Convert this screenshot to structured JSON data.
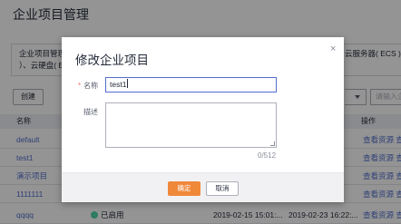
{
  "page": {
    "title": "企业项目管理",
    "notice": {
      "line1": "企业项目管理",
      "line2": "）、云硬盘( EVS",
      "line1_right": "云服务器( ECS )、列"
    },
    "create_label": "创建",
    "search_placeholder": "请输入企"
  },
  "table": {
    "headers": {
      "name": "名称",
      "operation": "操作"
    },
    "rows": [
      {
        "name": "default",
        "status": "",
        "created": "",
        "updated": "",
        "operation": "查看资源  查看"
      },
      {
        "name": "test1",
        "status": "",
        "created": "",
        "updated": "",
        "operation": "查看资源  查看"
      },
      {
        "name": "演示项目",
        "status": "",
        "created": "",
        "updated": "",
        "operation": "查看资源  查看"
      },
      {
        "name": "1111111",
        "status": "",
        "created": "",
        "updated": "",
        "operation": "查看资源  查看"
      },
      {
        "name": "qqqq",
        "status": "已启用",
        "created": "2019-02-15 15:01:...",
        "updated": "2019-02-23 16:22:...",
        "operation": "查看资源  查看"
      }
    ]
  },
  "dialog": {
    "title": "修改企业项目",
    "close_icon": "×",
    "name_required": "*",
    "name_label": "名称",
    "name_value": "test1",
    "description_label": "描述",
    "description_value": "",
    "counter": "0/512",
    "ok_label": "确定",
    "cancel_label": "取消"
  },
  "colors": {
    "primary_button": "#f0883a",
    "link": "#526ecc",
    "required": "#f66f6a",
    "status_enabled": "#50d4ab"
  }
}
